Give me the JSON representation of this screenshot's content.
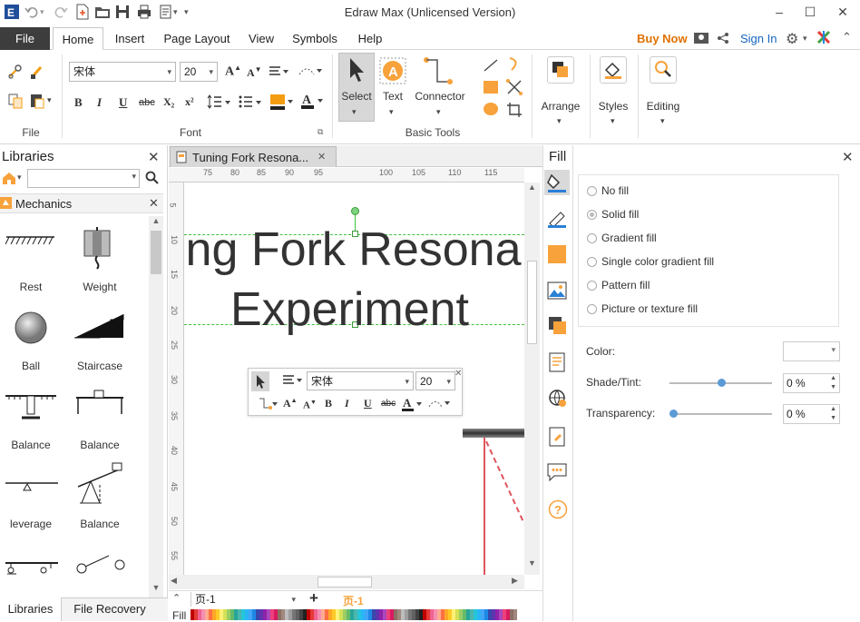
{
  "window": {
    "title": "Edraw Max (Unlicensed Version)"
  },
  "menu": {
    "file": "File",
    "tabs": [
      "Home",
      "Insert",
      "Page Layout",
      "View",
      "Symbols",
      "Help"
    ],
    "buy_now": "Buy Now",
    "sign_in": "Sign In"
  },
  "ribbon": {
    "font_name": "宋体",
    "font_size": "20",
    "select_label": "Select",
    "text_label": "Text",
    "connector_label": "Connector",
    "arrange_label": "Arrange",
    "styles_label": "Styles",
    "editing_label": "Editing",
    "groups": {
      "file": "File",
      "font": "Font",
      "basic_tools": "Basic Tools"
    },
    "glyphs": {
      "bold": "B",
      "italic": "I",
      "underline": "U",
      "strike": "abc",
      "sub": "X₂",
      "sup": "x²",
      "grow": "A",
      "shrink": "A"
    }
  },
  "libraries": {
    "title": "Libraries",
    "category": "Mechanics",
    "items": [
      {
        "label": "Rest",
        "icon": "rest-shape-icon"
      },
      {
        "label": "Weight",
        "icon": "weight-shape-icon"
      },
      {
        "label": "Ball",
        "icon": "ball-shape-icon"
      },
      {
        "label": "Staircase",
        "icon": "staircase-shape-icon"
      },
      {
        "label": "Balance",
        "icon": "balance-shape-icon"
      },
      {
        "label": "Balance",
        "icon": "balance-table-shape-icon"
      },
      {
        "label": "leverage",
        "icon": "leverage-shape-icon"
      },
      {
        "label": "Balance",
        "icon": "balance-scale-shape-icon"
      },
      {
        "label": "",
        "icon": "cart-shape-icon"
      },
      {
        "label": "",
        "icon": "pulley-shape-icon"
      }
    ],
    "bottom_tabs": [
      "Libraries",
      "File Recovery"
    ]
  },
  "document": {
    "tab_title": "Tuning Fork Resona...",
    "ruler_top": [
      "75",
      "80",
      "85",
      "90",
      "95",
      "100",
      "105",
      "110",
      "115"
    ],
    "ruler_left": [
      "5",
      "10",
      "15",
      "20",
      "25",
      "30",
      "35",
      "40",
      "45",
      "50",
      "55"
    ],
    "canvas_text_line1": "ing Fork Resona",
    "canvas_text_line2": "Experiment",
    "floating_font": "宋体",
    "floating_size": "20",
    "page_tab": "页-1",
    "page_tab_active": "页-1",
    "fill_label": "Fill"
  },
  "fill_panel": {
    "title": "Fill",
    "options": [
      "No fill",
      "Solid fill",
      "Gradient fill",
      "Single color gradient fill",
      "Pattern fill",
      "Picture or texture fill"
    ],
    "selected_option": "Solid fill",
    "color_label": "Color:",
    "shade_label": "Shade/Tint:",
    "shade_value": "0 %",
    "transparency_label": "Transparency:",
    "transparency_value": "0 %",
    "shade_level": 0.5,
    "transparency_level": 0
  },
  "colors": {
    "accent_orange": "#f7a23b",
    "buy_now": "#e07000",
    "sign_in": "#1565c0",
    "guide_green": "#3bc43b",
    "file_tab": "#3d3d3d"
  }
}
